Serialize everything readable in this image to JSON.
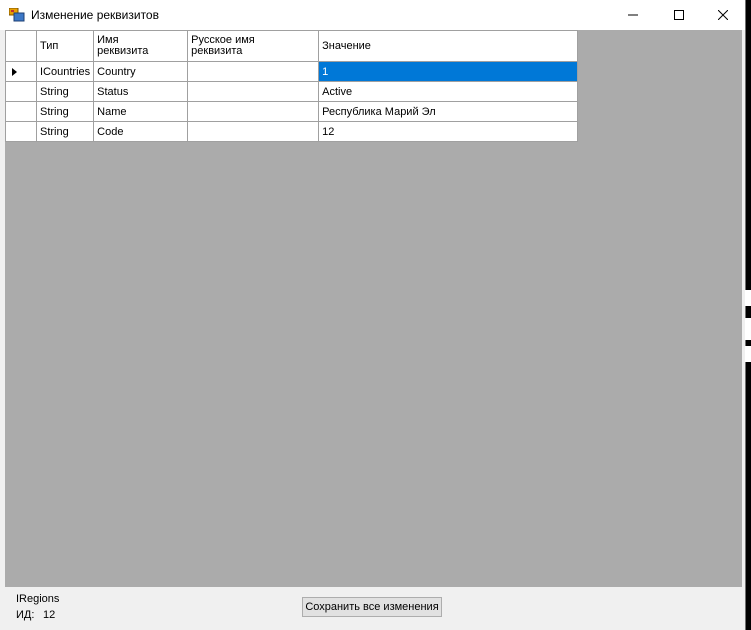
{
  "window": {
    "title": "Изменение реквизитов"
  },
  "grid": {
    "headers": {
      "type": "Тип",
      "name_line1": "Имя",
      "name_line2": "реквизита",
      "rus_line1": "Русское имя",
      "rus_line2": "реквизита",
      "value": "Значение"
    },
    "rows": [
      {
        "type": "ICountries",
        "name": "Country",
        "rus": "",
        "value": "1",
        "current": true
      },
      {
        "type": "String",
        "name": "Status",
        "rus": "",
        "value": "Active"
      },
      {
        "type": "String",
        "name": "Name",
        "rus": "",
        "value": "Республика Марий Эл"
      },
      {
        "type": "String",
        "name": "Code",
        "rus": "",
        "value": "12"
      }
    ]
  },
  "footer": {
    "entity": "IRegions",
    "id_label": "ИД:",
    "id_value": "12",
    "save_label": "Сохранить все изменения"
  },
  "colors": {
    "selection": "#0078d7",
    "client_bg": "#ababab"
  }
}
